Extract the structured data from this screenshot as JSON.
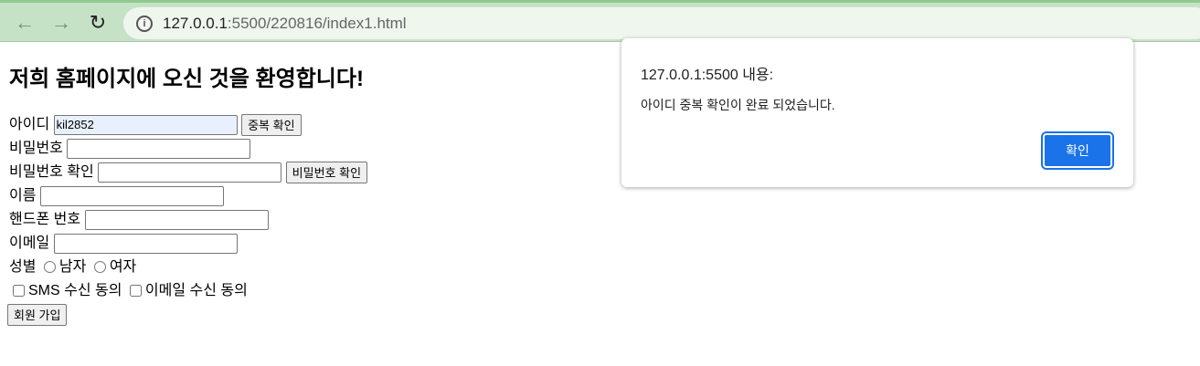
{
  "browser": {
    "back_icon": "arrow-left",
    "forward_icon": "arrow-right",
    "reload_icon": "reload",
    "url_host": "127.0.0.1",
    "url_rest": ":5500/220816/index1.html"
  },
  "page": {
    "title": "저희 홈페이지에 오신 것을 환영합니다!",
    "id_label": "아이디",
    "id_value": "kil2852",
    "dup_check_button": "중복 확인",
    "password_label": "비밀번호",
    "password_confirm_label": "비밀번호 확인",
    "password_confirm_button": "비밀번호 확인",
    "name_label": "이름",
    "phone_label": "핸드폰 번호",
    "email_label": "이메일",
    "gender_label": "성별",
    "male_label": "남자",
    "female_label": "여자",
    "sms_label": "SMS 수신 동의",
    "email_agree_label": "이메일 수신 동의",
    "signup_button": "회원 가입"
  },
  "dialog": {
    "title": "127.0.0.1:5500 내용:",
    "message": "아이디 중복 확인이 완료 되었습니다.",
    "ok_button": "확인",
    "accent": "#1a73e8"
  }
}
